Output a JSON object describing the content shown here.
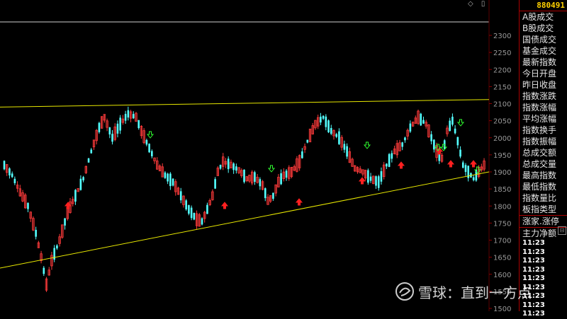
{
  "header": {
    "code": "880491"
  },
  "right_menu": {
    "items": [
      "A股成交",
      "B股成交",
      "国债成交",
      "基金成交",
      "最新指数",
      "今日开盘",
      "昨日收盘",
      "指数涨跌",
      "指数涨幅",
      "平均涨幅",
      "指数换手",
      "指数振幅",
      "总成交额",
      "总成交量",
      "最高指数",
      "最低指数",
      "指数量比",
      "板指类型"
    ],
    "extra": [
      "涨家.涨停",
      "主力净额"
    ],
    "times": [
      "11:23",
      "11:23",
      "11:23",
      "11:23",
      "11:23",
      "11:23",
      "11:23",
      "11:23",
      "11:23"
    ]
  },
  "watermark": {
    "text": "雪球：直到一方点"
  },
  "colors": {
    "up": "#ff3b3b",
    "down": "#54ffff",
    "trendline": "#e8e800",
    "grid": "#5a0000",
    "axis_text": "#9a9a9a"
  },
  "chart_data": {
    "type": "candlestick",
    "y_ticks": [
      1500,
      1550,
      1600,
      1650,
      1700,
      1750,
      1800,
      1850,
      1900,
      1950,
      2000,
      2050,
      2100,
      2150,
      2200,
      2250,
      2300
    ],
    "ylim": [
      1495,
      2320
    ],
    "trendlines": [
      {
        "from": [
          0,
          2090
        ],
        "to": [
          125,
          2112
        ]
      },
      {
        "from": [
          0,
          1618
        ],
        "to": [
          125,
          1900
        ]
      }
    ],
    "arrows_up": [
      16,
      56,
      75,
      86,
      104,
      110,
      116,
      112
    ],
    "arrows_down": [
      37,
      68,
      93,
      95,
      111,
      113,
      117
    ]
  }
}
